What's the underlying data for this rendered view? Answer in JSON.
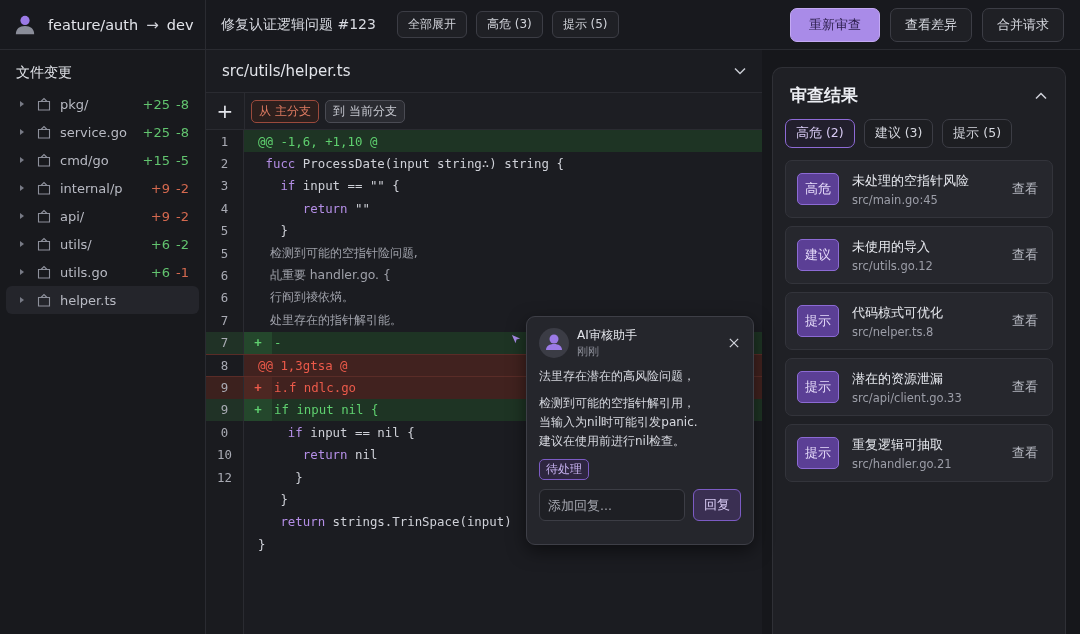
{
  "topbar": {
    "source_branch": "feature/auth",
    "arrow": "→",
    "target_branch": "dev",
    "title": "修复认证逻辑问题 #123",
    "filters": [
      {
        "label": "全部展开"
      },
      {
        "label": "高危 (3)"
      },
      {
        "label": "提示 (5)"
      }
    ],
    "actions": [
      {
        "label": "重新审查",
        "kind": "primary"
      },
      {
        "label": "查看差异",
        "kind": "secondary"
      },
      {
        "label": "合并请求",
        "kind": "secondary"
      }
    ]
  },
  "sidebar": {
    "title": "文件变更",
    "items": [
      {
        "name": "pkg/",
        "expanded": false,
        "selected": false,
        "added": {
          "text": "+25",
          "color": "#62c46f"
        },
        "removed": {
          "text": "-8",
          "color": "#62c46f"
        }
      },
      {
        "name": "service.go",
        "expanded": false,
        "selected": false,
        "added": {
          "text": "+25",
          "color": "#62c46f"
        },
        "removed": {
          "text": "-8",
          "color": "#62c46f"
        }
      },
      {
        "name": "cmd/go",
        "expanded": false,
        "selected": false,
        "added": {
          "text": "+15",
          "color": "#62c46f"
        },
        "removed": {
          "text": "-5",
          "color": "#62c46f"
        }
      },
      {
        "name": "internal/p",
        "expanded": false,
        "selected": false,
        "added": {
          "text": "+9",
          "color": "#d4694f"
        },
        "removed": {
          "text": "-2",
          "color": "#d4694f"
        }
      },
      {
        "name": "api/",
        "expanded": false,
        "selected": false,
        "added": {
          "text": "+9",
          "color": "#d4694f"
        },
        "removed": {
          "text": "-2",
          "color": "#d4694f"
        }
      },
      {
        "name": "utils/",
        "expanded": false,
        "selected": false,
        "added": {
          "text": "+6",
          "color": "#62c46f"
        },
        "removed": {
          "text": "-2",
          "color": "#62c46f"
        }
      },
      {
        "name": "utils.go",
        "expanded": false,
        "selected": false,
        "added": {
          "text": "+6",
          "color": "#62c46f"
        },
        "removed": {
          "text": "-1",
          "color": "#d4694f"
        }
      },
      {
        "name": "helper.ts",
        "expanded": false,
        "selected": true
      }
    ]
  },
  "diff": {
    "file": "src/utils/helper.ts",
    "add_button": "+",
    "from_tag": "从 主分支",
    "to_tag": "到 当前分支",
    "lines": [
      {
        "number": "1",
        "kind": "hunk-add",
        "segments": [
          {
            "kind": "plain",
            "text": "@@ -1,6, +1,10 @"
          }
        ]
      },
      {
        "number": "2",
        "kind": "context",
        "segments": [
          {
            "kind": "keyword",
            "text": " fucc"
          },
          {
            "kind": "plain",
            "text": " ProcessDate(input string∴) string {"
          }
        ]
      },
      {
        "number": "3",
        "kind": "context",
        "segments": [
          {
            "kind": "keyword",
            "text": "   if"
          },
          {
            "kind": "plain",
            "text": " input == \"\" {"
          }
        ]
      },
      {
        "number": "4",
        "kind": "context",
        "segments": [
          {
            "kind": "keyword",
            "text": "      return"
          },
          {
            "kind": "plain",
            "text": " \"\""
          }
        ]
      },
      {
        "number": "5",
        "kind": "context",
        "segments": [
          {
            "kind": "plain",
            "text": "   }"
          }
        ]
      },
      {
        "number": "5",
        "kind": "context",
        "segments": [
          {
            "kind": "comment",
            "text": "   检测到可能的空指针险问题,"
          }
        ]
      },
      {
        "number": "6",
        "kind": "context",
        "segments": [
          {
            "kind": "comment",
            "text": "   乩重要 handler.go. {"
          }
        ]
      },
      {
        "number": "6",
        "kind": "context",
        "segments": [
          {
            "kind": "comment",
            "text": "   行阎到祾依焫。"
          }
        ]
      },
      {
        "number": "7",
        "kind": "context",
        "segments": [
          {
            "kind": "comment",
            "text": "   处里存在的指针解引能。"
          }
        ]
      },
      {
        "number": "7",
        "kind": "add",
        "sign": "+",
        "segments": [
          {
            "kind": "plain",
            "text": "-"
          }
        ]
      },
      {
        "number": "8",
        "kind": "hunk-del",
        "segments": [
          {
            "kind": "plain",
            "text": "@@ 1,3gtsa @"
          }
        ]
      },
      {
        "number": "9",
        "kind": "del",
        "sign": "+",
        "segments": [
          {
            "kind": "plain",
            "text": "i.f ndlc.go"
          }
        ]
      },
      {
        "number": "9",
        "kind": "add",
        "sign": "+",
        "segments": [
          {
            "kind": "plain",
            "text": "if input nil {"
          }
        ]
      },
      {
        "number": "0",
        "kind": "context",
        "segments": [
          {
            "kind": "keyword",
            "text": "    if"
          },
          {
            "kind": "plain",
            "text": " input == nil {"
          }
        ]
      },
      {
        "number": "10",
        "kind": "context",
        "segments": [
          {
            "kind": "keyword",
            "text": "      return"
          },
          {
            "kind": "plain",
            "text": " nil"
          }
        ]
      },
      {
        "number": "12",
        "kind": "context",
        "segments": [
          {
            "kind": "plain",
            "text": "     }"
          }
        ]
      },
      {
        "kind": "context",
        "segments": [
          {
            "kind": "plain",
            "text": "   }"
          }
        ]
      },
      {
        "kind": "context",
        "segments": [
          {
            "kind": "keyword",
            "text": "   return"
          },
          {
            "kind": "plain",
            "text": " strings.TrinSpace(input)"
          }
        ]
      },
      {
        "kind": "context",
        "segments": [
          {
            "kind": "plain",
            "text": "}"
          }
        ]
      }
    ]
  },
  "comment": {
    "author": "AI审核助手",
    "time": "刚刚",
    "paragraphs": [
      [
        "法里存在潜在的高风险问题，"
      ],
      [
        "检测到可能的空指针解引用，",
        "当输入为nil时可能引发panic.",
        "建议在使用前进行nil检查。"
      ]
    ],
    "status": "待处理",
    "reply_placeholder": "添加回复...",
    "reply_button": "回复"
  },
  "review": {
    "title": "审查结果",
    "expanded": true,
    "filters": [
      {
        "label": "高危 (2)",
        "selected": true
      },
      {
        "label": "建议 (3)",
        "selected": false
      },
      {
        "label": "提示 (5)",
        "selected": false
      }
    ],
    "findings": [
      {
        "badge": "高危",
        "title": "未处理的空指针风险",
        "location": "src/main.go:45",
        "link": "查看"
      },
      {
        "badge": "建议",
        "title": "未使用的导入",
        "location": "src/utils.go.12",
        "link": "查看"
      },
      {
        "badge": "提示",
        "title": "代码椋式可优化",
        "location": "src/nelper.ts.8",
        "link": "查看"
      },
      {
        "badge": "提示",
        "title": "潜在的资源泄漏",
        "location": "src/api/client.go.33",
        "link": "查看"
      },
      {
        "badge": "提示",
        "title": "重复逻辑可抽取",
        "location": "src/handler.go.21",
        "link": "查看"
      }
    ]
  }
}
